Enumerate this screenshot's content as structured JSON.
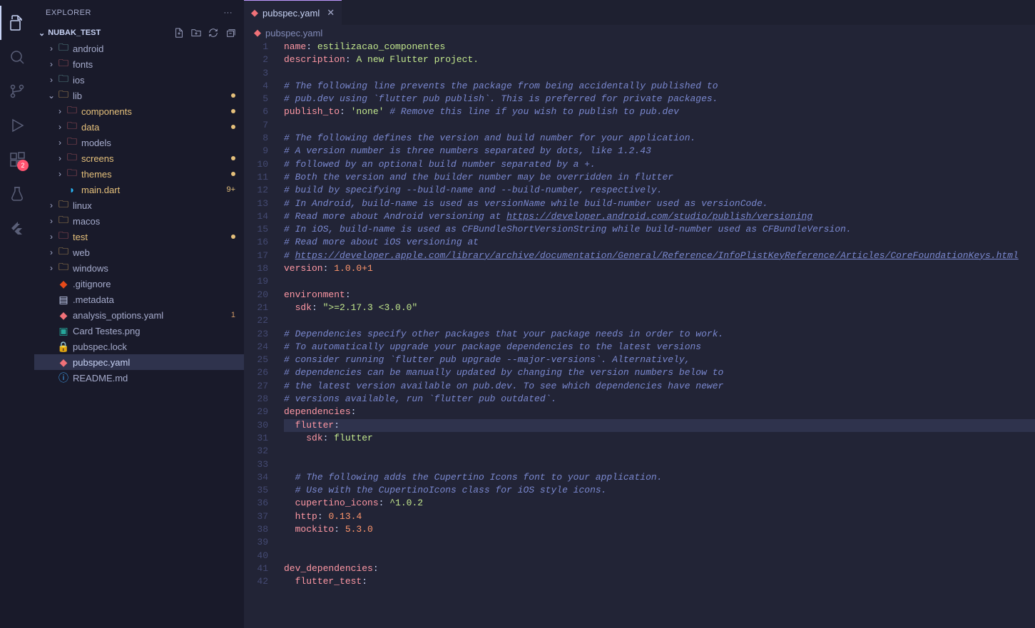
{
  "activityBar": {
    "extensionsBadge": "2"
  },
  "sidebar": {
    "title": "EXPLORER",
    "ellipsis": "···",
    "folderName": "NUBAK_TEST",
    "tree": [
      {
        "indent": 1,
        "type": "folder",
        "label": "android",
        "chev": ">",
        "color": "folder-icon"
      },
      {
        "indent": 1,
        "type": "folder",
        "label": "fonts",
        "chev": ">",
        "color": "folder-red"
      },
      {
        "indent": 1,
        "type": "folder",
        "label": "ios",
        "chev": ">",
        "color": "folder-icon"
      },
      {
        "indent": 1,
        "type": "folder",
        "label": "lib",
        "chev": "v",
        "color": "folder-yellow",
        "modDot": true
      },
      {
        "indent": 2,
        "type": "folder",
        "label": "components",
        "chev": ">",
        "color": "folder-red",
        "modified": true,
        "modDot": true
      },
      {
        "indent": 2,
        "type": "folder",
        "label": "data",
        "chev": ">",
        "color": "folder-red",
        "modified": true,
        "modDot": true
      },
      {
        "indent": 2,
        "type": "folder",
        "label": "models",
        "chev": ">",
        "color": "folder-red"
      },
      {
        "indent": 2,
        "type": "folder",
        "label": "screens",
        "chev": ">",
        "color": "folder-red",
        "modified": true,
        "modDot": true
      },
      {
        "indent": 2,
        "type": "folder",
        "label": "themes",
        "chev": ">",
        "color": "folder-red",
        "modified": true,
        "modDot": true
      },
      {
        "indent": 2,
        "type": "file",
        "label": "main.dart",
        "icon": "dart",
        "modified": true,
        "status": "9+"
      },
      {
        "indent": 1,
        "type": "folder",
        "label": "linux",
        "chev": ">",
        "color": "folder-yellow"
      },
      {
        "indent": 1,
        "type": "folder",
        "label": "macos",
        "chev": ">",
        "color": "folder-yellow"
      },
      {
        "indent": 1,
        "type": "folder",
        "label": "test",
        "chev": ">",
        "color": "folder-red",
        "modified": true,
        "modDot": true
      },
      {
        "indent": 1,
        "type": "folder",
        "label": "web",
        "chev": ">",
        "color": "folder-yellow"
      },
      {
        "indent": 1,
        "type": "folder",
        "label": "windows",
        "chev": ">",
        "color": "folder-yellow"
      },
      {
        "indent": 1,
        "type": "file",
        "label": ".gitignore",
        "icon": "git"
      },
      {
        "indent": 1,
        "type": "file",
        "label": ".metadata",
        "icon": "generic"
      },
      {
        "indent": 1,
        "type": "file",
        "label": "analysis_options.yaml",
        "icon": "yaml",
        "status": "1",
        "statusClass": "badge-1"
      },
      {
        "indent": 1,
        "type": "file",
        "label": "Card Testes.png",
        "icon": "image"
      },
      {
        "indent": 1,
        "type": "file",
        "label": "pubspec.lock",
        "icon": "lock"
      },
      {
        "indent": 1,
        "type": "file",
        "label": "pubspec.yaml",
        "icon": "yaml",
        "selected": true
      },
      {
        "indent": 1,
        "type": "file",
        "label": "README.md",
        "icon": "info"
      }
    ]
  },
  "editor": {
    "tabName": "pubspec.yaml",
    "breadcrumb": "pubspec.yaml",
    "highlightLine": 30,
    "lines": [
      {
        "n": 1,
        "tokens": [
          {
            "t": "name",
            "cls": "k"
          },
          {
            "t": ": "
          },
          {
            "t": "estilizacao_componentes",
            "cls": "s"
          }
        ]
      },
      {
        "n": 2,
        "tokens": [
          {
            "t": "description",
            "cls": "k"
          },
          {
            "t": ": "
          },
          {
            "t": "A new Flutter project.",
            "cls": "s"
          }
        ]
      },
      {
        "n": 3,
        "tokens": []
      },
      {
        "n": 4,
        "tokens": [
          {
            "t": "# The following line prevents the package from being accidentally published to",
            "cls": "c"
          }
        ]
      },
      {
        "n": 5,
        "tokens": [
          {
            "t": "# pub.dev using `flutter pub publish`. This is preferred for private packages.",
            "cls": "c"
          }
        ]
      },
      {
        "n": 6,
        "tokens": [
          {
            "t": "publish_to",
            "cls": "k"
          },
          {
            "t": ": "
          },
          {
            "t": "'none'",
            "cls": "s"
          },
          {
            "t": " "
          },
          {
            "t": "# Remove this line if you wish to publish to pub.dev",
            "cls": "c"
          }
        ]
      },
      {
        "n": 7,
        "tokens": []
      },
      {
        "n": 8,
        "tokens": [
          {
            "t": "# The following defines the version and build number for your application.",
            "cls": "c"
          }
        ]
      },
      {
        "n": 9,
        "tokens": [
          {
            "t": "# A version number is three numbers separated by dots, like 1.2.43",
            "cls": "c"
          }
        ]
      },
      {
        "n": 10,
        "tokens": [
          {
            "t": "# followed by an optional build number separated by a +.",
            "cls": "c"
          }
        ]
      },
      {
        "n": 11,
        "tokens": [
          {
            "t": "# Both the version and the builder number may be overridden in flutter",
            "cls": "c"
          }
        ]
      },
      {
        "n": 12,
        "tokens": [
          {
            "t": "# build by specifying --build-name and --build-number, respectively.",
            "cls": "c"
          }
        ]
      },
      {
        "n": 13,
        "tokens": [
          {
            "t": "# In Android, build-name is used as versionName while build-number used as versionCode.",
            "cls": "c"
          }
        ]
      },
      {
        "n": 14,
        "tokens": [
          {
            "t": "# Read more about Android versioning at ",
            "cls": "c"
          },
          {
            "t": "https://developer.android.com/studio/publish/versioning",
            "cls": "link"
          }
        ]
      },
      {
        "n": 15,
        "tokens": [
          {
            "t": "# In iOS, build-name is used as CFBundleShortVersionString while build-number used as CFBundleVersion.",
            "cls": "c"
          }
        ]
      },
      {
        "n": 16,
        "tokens": [
          {
            "t": "# Read more about iOS versioning at",
            "cls": "c"
          }
        ]
      },
      {
        "n": 17,
        "tokens": [
          {
            "t": "# ",
            "cls": "c"
          },
          {
            "t": "https://developer.apple.com/library/archive/documentation/General/Reference/InfoPlistKeyReference/Articles/CoreFoundationKeys.html",
            "cls": "link"
          }
        ]
      },
      {
        "n": 18,
        "tokens": [
          {
            "t": "version",
            "cls": "k"
          },
          {
            "t": ": "
          },
          {
            "t": "1.0.0+1",
            "cls": "v"
          }
        ]
      },
      {
        "n": 19,
        "tokens": []
      },
      {
        "n": 20,
        "tokens": [
          {
            "t": "environment",
            "cls": "k"
          },
          {
            "t": ":"
          }
        ]
      },
      {
        "n": 21,
        "tokens": [
          {
            "t": "  "
          },
          {
            "t": "sdk",
            "cls": "k"
          },
          {
            "t": ": "
          },
          {
            "t": "\">=2.17.3 <3.0.0\"",
            "cls": "s"
          }
        ]
      },
      {
        "n": 22,
        "tokens": []
      },
      {
        "n": 23,
        "tokens": [
          {
            "t": "# Dependencies specify other packages that your package needs in order to work.",
            "cls": "c"
          }
        ]
      },
      {
        "n": 24,
        "tokens": [
          {
            "t": "# To automatically upgrade your package dependencies to the latest versions",
            "cls": "c"
          }
        ]
      },
      {
        "n": 25,
        "tokens": [
          {
            "t": "# consider running `flutter pub upgrade --major-versions`. Alternatively,",
            "cls": "c"
          }
        ]
      },
      {
        "n": 26,
        "tokens": [
          {
            "t": "# dependencies can be manually updated by changing the version numbers below to",
            "cls": "c"
          }
        ]
      },
      {
        "n": 27,
        "tokens": [
          {
            "t": "# the latest version available on pub.dev. To see which dependencies have newer",
            "cls": "c"
          }
        ]
      },
      {
        "n": 28,
        "tokens": [
          {
            "t": "# versions available, run `flutter pub outdated`.",
            "cls": "c"
          }
        ]
      },
      {
        "n": 29,
        "tokens": [
          {
            "t": "dependencies",
            "cls": "k"
          },
          {
            "t": ":"
          }
        ]
      },
      {
        "n": 30,
        "tokens": [
          {
            "t": "  "
          },
          {
            "t": "flutter",
            "cls": "k"
          },
          {
            "t": ":"
          }
        ]
      },
      {
        "n": 31,
        "tokens": [
          {
            "t": "    "
          },
          {
            "t": "sdk",
            "cls": "k"
          },
          {
            "t": ": "
          },
          {
            "t": "flutter",
            "cls": "s"
          }
        ]
      },
      {
        "n": 32,
        "tokens": []
      },
      {
        "n": 33,
        "tokens": []
      },
      {
        "n": 34,
        "tokens": [
          {
            "t": "  "
          },
          {
            "t": "# The following adds the Cupertino Icons font to your application.",
            "cls": "c"
          }
        ]
      },
      {
        "n": 35,
        "tokens": [
          {
            "t": "  "
          },
          {
            "t": "# Use with the CupertinoIcons class for iOS style icons.",
            "cls": "c"
          }
        ]
      },
      {
        "n": 36,
        "tokens": [
          {
            "t": "  "
          },
          {
            "t": "cupertino_icons",
            "cls": "k"
          },
          {
            "t": ": "
          },
          {
            "t": "^1.0.2",
            "cls": "s"
          }
        ]
      },
      {
        "n": 37,
        "tokens": [
          {
            "t": "  "
          },
          {
            "t": "http",
            "cls": "k"
          },
          {
            "t": ": "
          },
          {
            "t": "0.13.4",
            "cls": "v"
          }
        ]
      },
      {
        "n": 38,
        "tokens": [
          {
            "t": "  "
          },
          {
            "t": "mockito",
            "cls": "k"
          },
          {
            "t": ": "
          },
          {
            "t": "5.3.0",
            "cls": "v"
          }
        ]
      },
      {
        "n": 39,
        "tokens": []
      },
      {
        "n": 40,
        "tokens": []
      },
      {
        "n": 41,
        "tokens": [
          {
            "t": "dev_dependencies",
            "cls": "k"
          },
          {
            "t": ":"
          }
        ]
      },
      {
        "n": 42,
        "tokens": [
          {
            "t": "  "
          },
          {
            "t": "flutter_test",
            "cls": "k"
          },
          {
            "t": ":"
          }
        ]
      }
    ]
  }
}
